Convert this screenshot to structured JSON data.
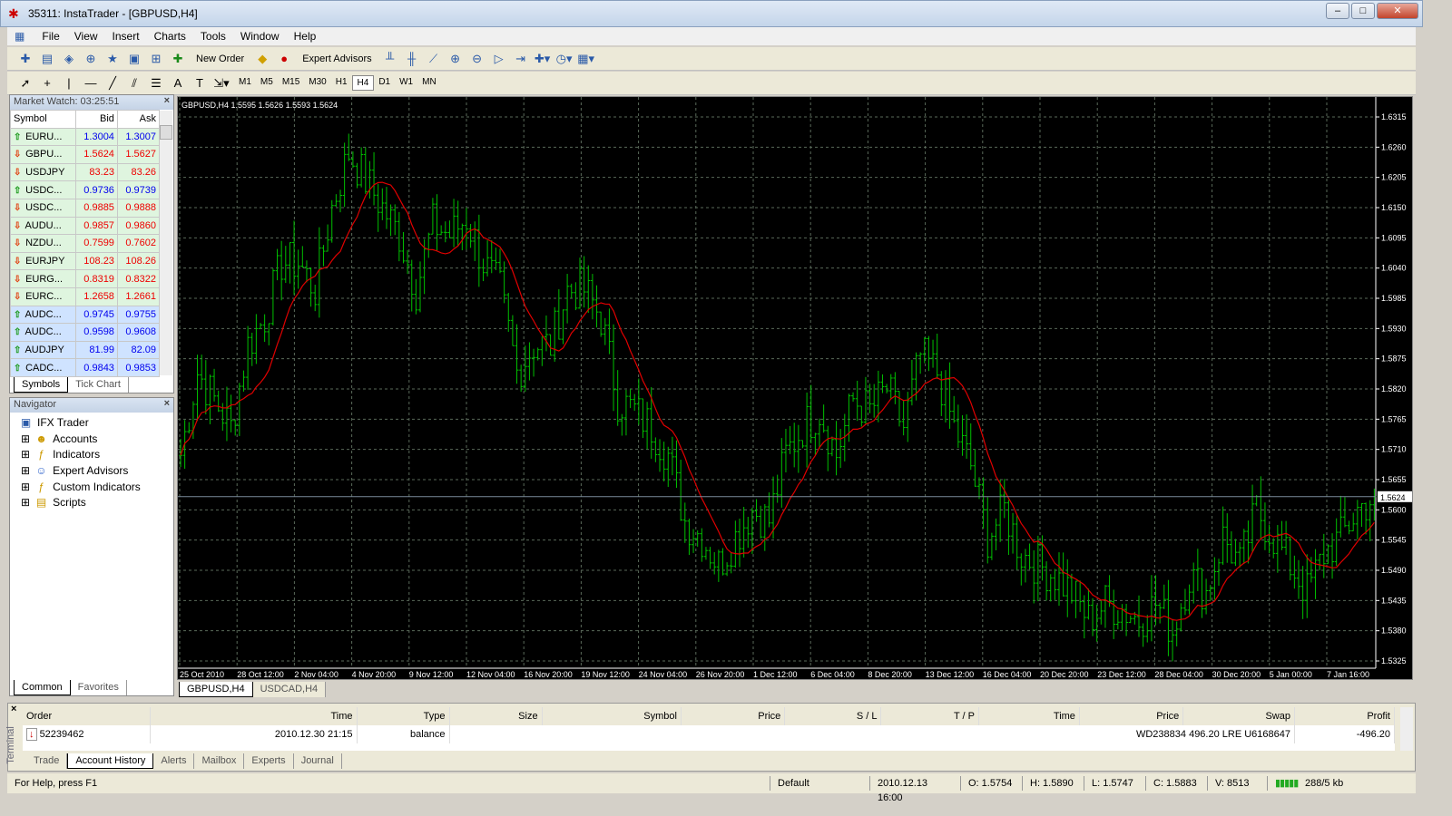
{
  "window": {
    "title": "35311: InstaTrader - [GBPUSD,H4]"
  },
  "menu": [
    "File",
    "View",
    "Insert",
    "Charts",
    "Tools",
    "Window",
    "Help"
  ],
  "toolbar": {
    "new_order": "New Order",
    "expert_advisors": "Expert Advisors",
    "timeframes": [
      "M1",
      "M5",
      "M15",
      "M30",
      "H1",
      "H4",
      "D1",
      "W1",
      "MN"
    ],
    "selected_timeframe": "H4"
  },
  "market_watch": {
    "title": "Market Watch: 03:25:51",
    "headers": [
      "Symbol",
      "Bid",
      "Ask"
    ],
    "rows": [
      {
        "symbol": "EURU...",
        "bid": "1.3004",
        "ask": "1.3007",
        "dir": "up"
      },
      {
        "symbol": "GBPU...",
        "bid": "1.5624",
        "ask": "1.5627",
        "dir": "down"
      },
      {
        "symbol": "USDJPY",
        "bid": "83.23",
        "ask": "83.26",
        "dir": "down"
      },
      {
        "symbol": "USDC...",
        "bid": "0.9736",
        "ask": "0.9739",
        "dir": "up"
      },
      {
        "symbol": "USDC...",
        "bid": "0.9885",
        "ask": "0.9888",
        "dir": "down"
      },
      {
        "symbol": "AUDU...",
        "bid": "0.9857",
        "ask": "0.9860",
        "dir": "down"
      },
      {
        "symbol": "NZDU...",
        "bid": "0.7599",
        "ask": "0.7602",
        "dir": "down"
      },
      {
        "symbol": "EURJPY",
        "bid": "108.23",
        "ask": "108.26",
        "dir": "down"
      },
      {
        "symbol": "EURG...",
        "bid": "0.8319",
        "ask": "0.8322",
        "dir": "down"
      },
      {
        "symbol": "EURC...",
        "bid": "1.2658",
        "ask": "1.2661",
        "dir": "down"
      },
      {
        "symbol": "AUDC...",
        "bid": "0.9745",
        "ask": "0.9755",
        "dir": "up"
      },
      {
        "symbol": "AUDC...",
        "bid": "0.9598",
        "ask": "0.9608",
        "dir": "up"
      },
      {
        "symbol": "AUDJPY",
        "bid": "81.99",
        "ask": "82.09",
        "dir": "up"
      },
      {
        "symbol": "CADC...",
        "bid": "0.9843",
        "ask": "0.9853",
        "dir": "up"
      }
    ],
    "tabs": [
      "Symbols",
      "Tick Chart"
    ]
  },
  "navigator": {
    "title": "Navigator",
    "items": [
      "IFX Trader",
      "Accounts",
      "Indicators",
      "Expert Advisors",
      "Custom Indicators",
      "Scripts"
    ],
    "tabs": [
      "Common",
      "Favorites"
    ]
  },
  "chart_tabs": [
    "GBPUSD,H4",
    "USDCAD,H4"
  ],
  "chart_data": {
    "type": "bar",
    "title": "GBPUSD,H4  1.5595 1.5626 1.5593 1.5624",
    "ylim": [
      1.5325,
      1.6315
    ],
    "yticks": [
      "1.6315",
      "1.6260",
      "1.6205",
      "1.6150",
      "1.6095",
      "1.6040",
      "1.5985",
      "1.5930",
      "1.5875",
      "1.5820",
      "1.5765",
      "1.5710",
      "1.5655",
      "1.5600",
      "1.5545",
      "1.5490",
      "1.5435",
      "1.5380",
      "1.5325"
    ],
    "xticks": [
      "25 Oct 2010",
      "28 Oct 12:00",
      "2 Nov 04:00",
      "4 Nov 20:00",
      "9 Nov 12:00",
      "12 Nov 04:00",
      "16 Nov 20:00",
      "19 Nov 12:00",
      "24 Nov 04:00",
      "26 Nov 20:00",
      "1 Dec 12:00",
      "6 Dec 04:00",
      "8 Dec 20:00",
      "13 Dec 12:00",
      "16 Dec 04:00",
      "20 Dec 20:00",
      "23 Dec 12:00",
      "28 Dec 04:00",
      "30 Dec 20:00",
      "5 Jan 00:00",
      "7 Jan 16:00"
    ],
    "current_price": "1.5624",
    "bar_color": "#00c000",
    "ma_color": "#e00000",
    "close": [
      1.57,
      1.585,
      1.58,
      1.575,
      1.59,
      1.595,
      1.605,
      1.605,
      1.6,
      1.615,
      1.625,
      1.62,
      1.615,
      1.61,
      1.6,
      1.612,
      1.61,
      1.613,
      1.605,
      1.6,
      1.585,
      1.59,
      1.59,
      1.6,
      1.6,
      1.595,
      1.58,
      1.578,
      1.575,
      1.57,
      1.558,
      1.555,
      1.55,
      1.555,
      1.56,
      1.558,
      1.57,
      1.575,
      1.578,
      1.57,
      1.58,
      1.578,
      1.582,
      1.575,
      1.588,
      1.585,
      1.575,
      1.568,
      1.555,
      1.56,
      1.552,
      1.55,
      1.548,
      1.545,
      1.54,
      1.543,
      1.542,
      1.54,
      1.543,
      1.538,
      1.548,
      1.545,
      1.555,
      1.55,
      1.56,
      1.555,
      1.55,
      1.545,
      1.552,
      1.555,
      1.56,
      1.5624
    ]
  },
  "terminal": {
    "label": "Terminal",
    "headers": [
      "Order",
      "Time",
      "Type",
      "Size",
      "Symbol",
      "Price",
      "S / L",
      "T / P",
      "Time",
      "Price",
      "Swap",
      "Profit"
    ],
    "rows": [
      {
        "order": "52239462",
        "time": "2010.12.30 21:15",
        "type": "balance",
        "comment": "WD238834 496.20 LRE U6168647",
        "profit": "-496.20"
      }
    ],
    "tabs": [
      "Trade",
      "Account History",
      "Alerts",
      "Mailbox",
      "Experts",
      "Journal"
    ],
    "selected_tab": "Account History"
  },
  "status": {
    "help": "For Help, press F1",
    "profile": "Default",
    "datetime": "2010.12.13 16:00",
    "open": "O: 1.5754",
    "high": "H: 1.5890",
    "low": "L: 1.5747",
    "close": "C: 1.5883",
    "volume": "V: 8513",
    "traffic": "288/5 kb"
  }
}
